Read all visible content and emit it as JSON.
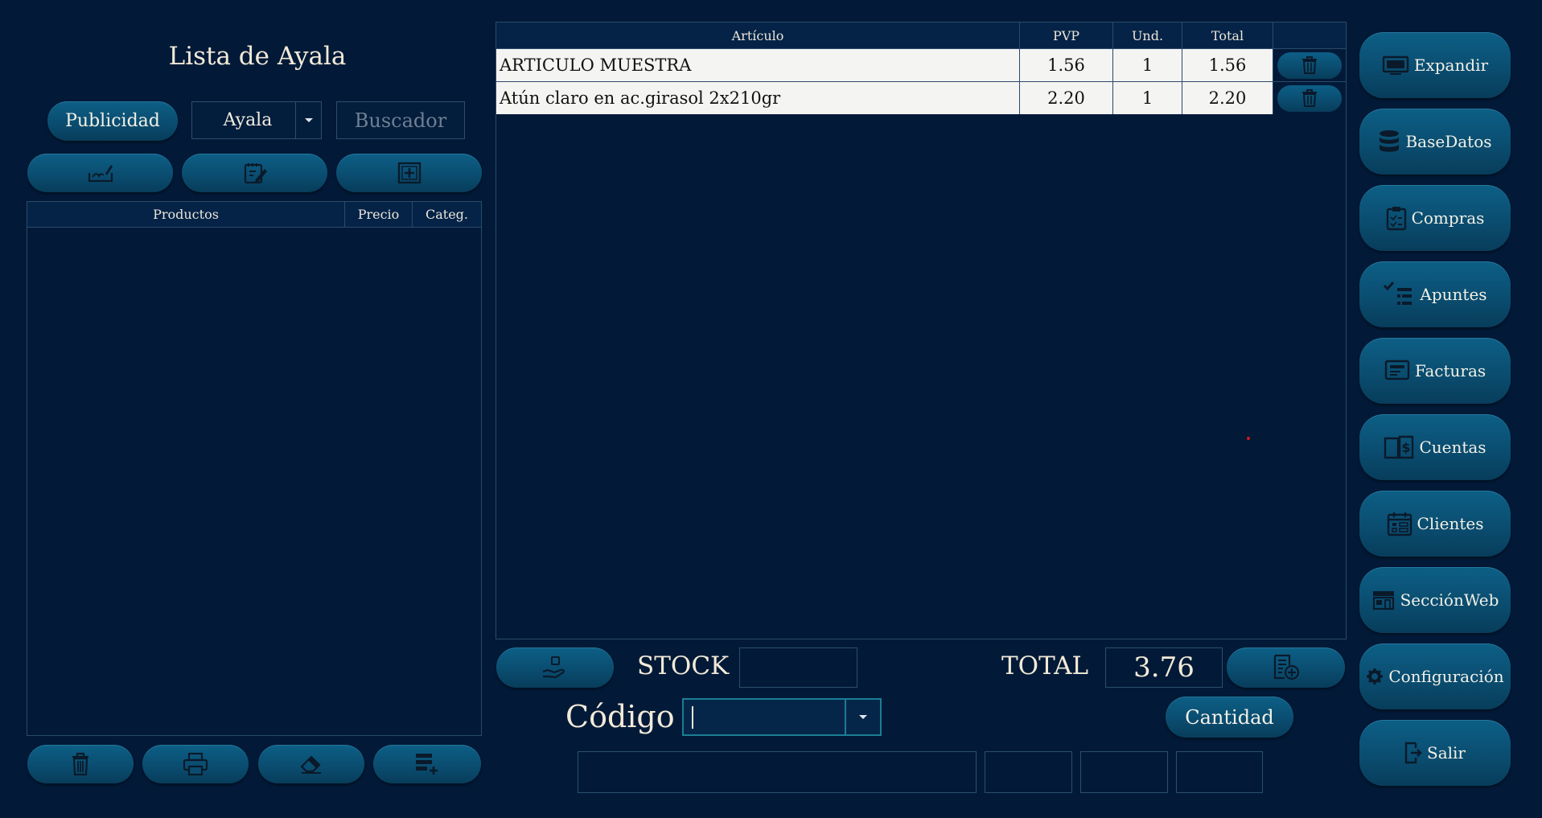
{
  "left_panel": {
    "title": "Lista de Ayala",
    "publicidad_label": "Publicidad",
    "list_select_value": "Ayala",
    "search_placeholder": "Buscador",
    "products_table": {
      "headers": [
        "Productos",
        "Precio",
        "Categ."
      ],
      "rows": []
    },
    "top_tools": [
      "signature-edit-icon",
      "edit-note-icon",
      "add-box-icon"
    ],
    "bottom_tools": [
      "trash-icon",
      "printer-icon",
      "eraser-icon",
      "add-list-icon"
    ]
  },
  "cart": {
    "headers": [
      "Artículo",
      "PVP",
      "Und.",
      "Total"
    ],
    "rows": [
      {
        "articulo": "ARTICULO MUESTRA",
        "pvp": "1.56",
        "und": "1",
        "total": "1.56"
      },
      {
        "articulo": "Atún claro en ac.girasol 2x210gr",
        "pvp": "2.20",
        "und": "1",
        "total": "2.20"
      }
    ]
  },
  "bottom": {
    "stock_label": "STOCK",
    "stock_value": "",
    "total_label": "TOTAL",
    "total_value": "3.76",
    "codigo_label": "Código",
    "codigo_value": "",
    "cantidad_label": "Cantidad"
  },
  "nav": [
    {
      "label": "Expandir",
      "icon": "monitor-icon"
    },
    {
      "label": "BaseDatos",
      "icon": "database-icon"
    },
    {
      "label": "Compras",
      "icon": "clipboard-icon"
    },
    {
      "label": "Apuntes",
      "icon": "checklist-icon"
    },
    {
      "label": "Facturas",
      "icon": "invoice-icon"
    },
    {
      "label": "Cuentas",
      "icon": "accounts-book-icon"
    },
    {
      "label": "Clientes",
      "icon": "calendar-icon"
    },
    {
      "label": "SecciónWeb",
      "icon": "store-icon"
    },
    {
      "label": "Configuración",
      "icon": "gear-icon"
    },
    {
      "label": "Salir",
      "icon": "exit-icon"
    }
  ],
  "colors": {
    "background": "#021a38",
    "button": "#0a4d70",
    "border": "#2a4a6a",
    "accent": "#1b7d94"
  }
}
